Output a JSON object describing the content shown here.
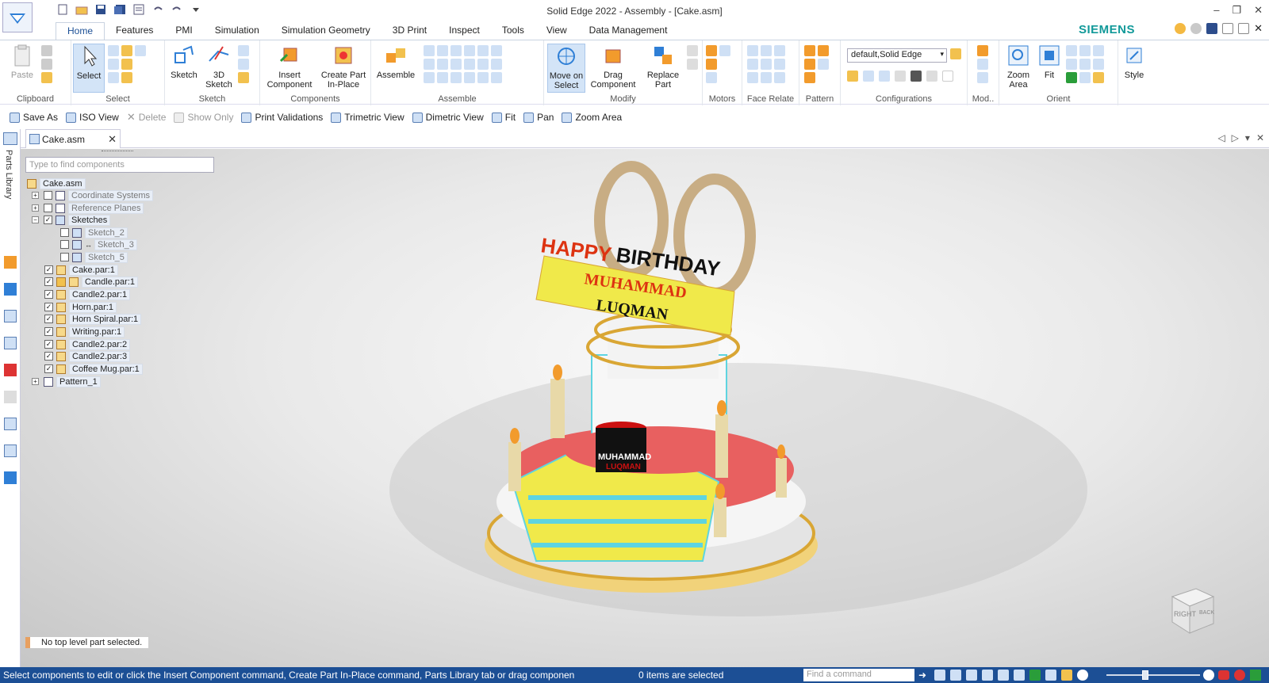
{
  "window": {
    "title": "Solid Edge 2022 - Assembly - [Cake.asm]"
  },
  "tabs": [
    "Home",
    "Features",
    "PMI",
    "Simulation",
    "Simulation Geometry",
    "3D Print",
    "Inspect",
    "Tools",
    "View",
    "Data Management"
  ],
  "brand": "SIEMENS",
  "ribbon": {
    "clipboard": {
      "paste": "Paste",
      "label": "Clipboard"
    },
    "select": {
      "select": "Select",
      "label": "Select"
    },
    "sketch": {
      "sketch": "Sketch",
      "sketch3d_1": "3D",
      "sketch3d_2": "Sketch",
      "label": "Sketch"
    },
    "components": {
      "insert_1": "Insert",
      "insert_2": "Component",
      "create_1": "Create Part",
      "create_2": "In-Place",
      "label": "Components"
    },
    "assemble": {
      "btn": "Assemble",
      "label": "Assemble"
    },
    "modify": {
      "move_1": "Move on",
      "move_2": "Select",
      "drag_1": "Drag",
      "drag_2": "Component",
      "replace_1": "Replace",
      "replace_2": "Part",
      "label": "Modify"
    },
    "motors": {
      "label": "Motors"
    },
    "face_relate": {
      "label": "Face Relate"
    },
    "pattern": {
      "label": "Pattern"
    },
    "configurations": {
      "value": "default,Solid Edge",
      "label": "Configurations"
    },
    "mod": {
      "label": "Mod.."
    },
    "orient": {
      "zoom_1": "Zoom",
      "zoom_2": "Area",
      "fit": "Fit",
      "label": "Orient"
    },
    "style": {
      "btn": "Style"
    }
  },
  "view_toolbar": {
    "save_as": "Save As",
    "iso": "ISO View",
    "delete": "Delete",
    "show_only": "Show Only",
    "print_validations": "Print Validations",
    "trimetric": "Trimetric View",
    "dimetric": "Dimetric View",
    "fit": "Fit",
    "pan": "Pan",
    "zoom_area": "Zoom Area"
  },
  "left_panel": {
    "parts_library": "Parts Library"
  },
  "doc_tab": {
    "name": "Cake.asm"
  },
  "pathfinder": {
    "search_placeholder": "Type to find components",
    "root": "Cake.asm",
    "items": [
      {
        "label": "Coordinate Systems"
      },
      {
        "label": "Reference Planes"
      },
      {
        "label": "Sketches"
      },
      {
        "label": "Sketch_2"
      },
      {
        "label": "Sketch_3"
      },
      {
        "label": "Sketch_5"
      },
      {
        "label": "Cake.par:1"
      },
      {
        "label": "Candle.par:1"
      },
      {
        "label": "Candle2.par:1"
      },
      {
        "label": "Horn.par:1"
      },
      {
        "label": "Horn Spiral.par:1"
      },
      {
        "label": "Writing.par:1"
      },
      {
        "label": "Candle2.par:2"
      },
      {
        "label": "Candle2.par:3"
      },
      {
        "label": "Coffee Mug.par:1"
      },
      {
        "label": "Pattern_1"
      }
    ]
  },
  "model": {
    "happy": "HAPPY",
    "birthday": "BIRTHDAY",
    "name1": "MUHAMMAD",
    "name2": "LUQMAN",
    "mug1": "MUHAMMAD",
    "mug2": "LUQMAN"
  },
  "viewcube": {
    "right": "RIGHT",
    "back": "BACK"
  },
  "status": {
    "selection_msg": "No top level part selected.",
    "prompt": "Select components to edit or click the Insert Component command, Create Part In-Place command, Parts Library tab or drag componen",
    "count": "0 items are selected",
    "command_placeholder": "Find a command"
  }
}
